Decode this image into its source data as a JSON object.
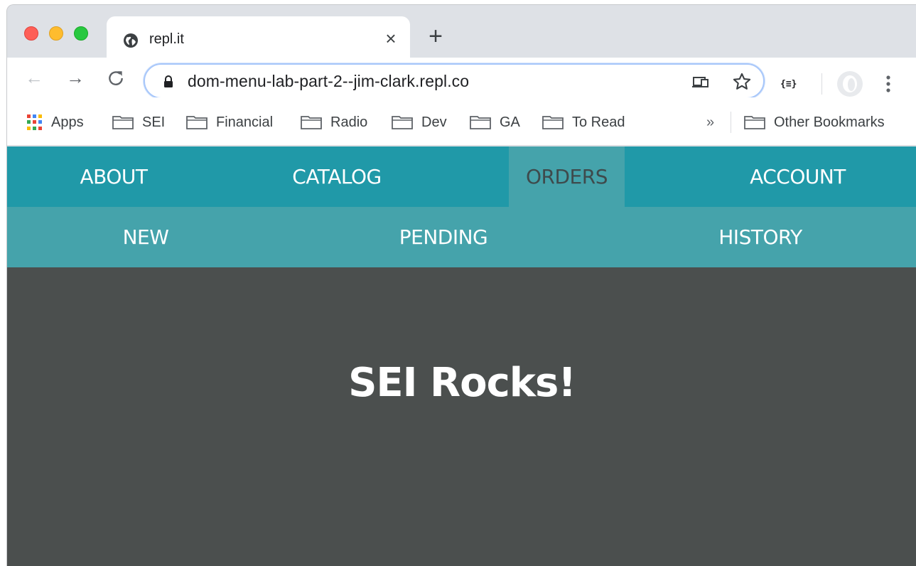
{
  "browser": {
    "tab": {
      "title": "repl.it",
      "close": "×"
    },
    "new_tab": "+",
    "url": "dom-menu-lab-part-2--jim-clark.repl.co",
    "ext_label": "{≡}",
    "bookmarks": [
      {
        "label": "Apps",
        "icon": "apps-grid-icon"
      },
      {
        "label": "SEI",
        "icon": "folder-icon"
      },
      {
        "label": "Financial",
        "icon": "folder-icon"
      },
      {
        "label": "Radio",
        "icon": "folder-icon"
      },
      {
        "label": "Dev",
        "icon": "folder-icon"
      },
      {
        "label": "GA",
        "icon": "folder-icon"
      },
      {
        "label": "To Read",
        "icon": "folder-icon"
      }
    ],
    "overflow": "»",
    "other_bookmarks": "Other Bookmarks"
  },
  "page": {
    "top_menu": [
      {
        "label": "ABOUT",
        "active": false
      },
      {
        "label": "CATALOG",
        "active": false
      },
      {
        "label": "ORDERS",
        "active": true
      },
      {
        "label": "ACCOUNT",
        "active": false
      }
    ],
    "sub_menu": [
      {
        "label": "NEW"
      },
      {
        "label": "PENDING"
      },
      {
        "label": "HISTORY"
      }
    ],
    "hero_text": "SEI Rocks!"
  },
  "colors": {
    "nav_main": "#2099a8",
    "nav_sub": "#45a3ab",
    "page_bg": "#4b4f4e",
    "active_text": "#3e4a4c"
  }
}
